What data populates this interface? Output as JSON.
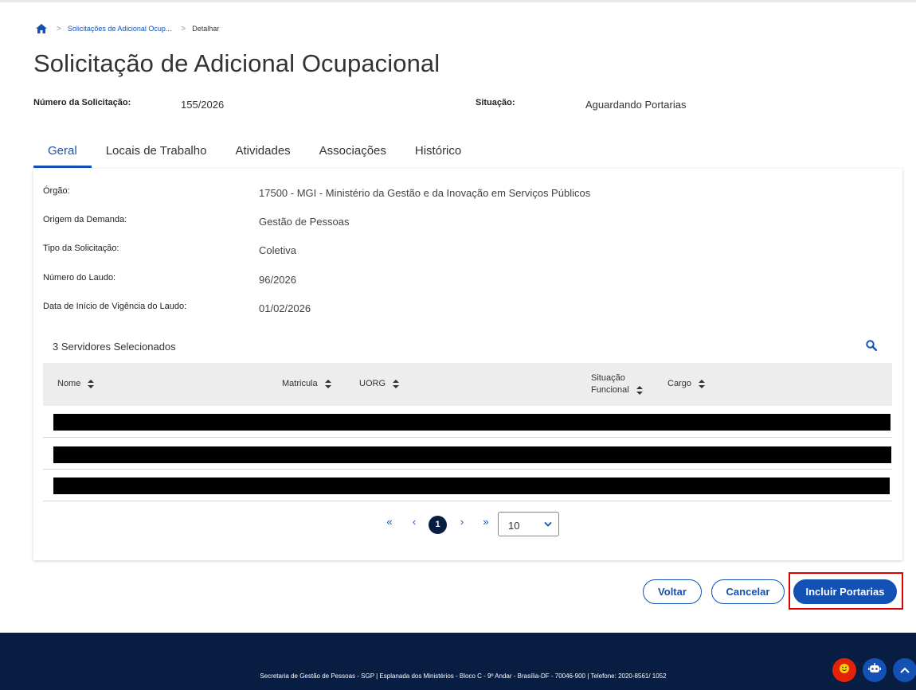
{
  "breadcrumb": {
    "items": [
      "Solicitações de Adicional Ocup...",
      "Detalhar"
    ]
  },
  "page": {
    "title": "Solicitação de Adicional Ocupacional"
  },
  "summary": {
    "numero_label": "Número da Solicitação:",
    "numero_value": "155/2026",
    "situacao_label": "Situação:",
    "situacao_value": "Aguardando Portarias"
  },
  "tabs": [
    {
      "label": "Geral",
      "active": true
    },
    {
      "label": "Locais de Trabalho",
      "active": false
    },
    {
      "label": "Atividades",
      "active": false
    },
    {
      "label": "Associações",
      "active": false
    },
    {
      "label": "Histórico",
      "active": false
    }
  ],
  "details": [
    {
      "label": "Órgão:",
      "value": "17500 - MGI - Ministério da Gestão e da Inovação em Serviços Públicos"
    },
    {
      "label": "Origem da Demanda:",
      "value": "Gestão de Pessoas"
    },
    {
      "label": "Tipo da Solicitação:",
      "value": "Coletiva"
    },
    {
      "label": "Número do Laudo:",
      "value": "96/2026"
    },
    {
      "label": "Data de Início de Vigência do Laudo:",
      "value": "01/02/2026"
    }
  ],
  "servidores": {
    "title": "3 Servidores Selecionados",
    "columns": {
      "nome": "Nome",
      "matricula": "Matricula",
      "uorg": "UORG",
      "situacao_1": "Situação",
      "situacao_2": "Funcional",
      "cargo": "Cargo"
    }
  },
  "pagination": {
    "first": "«",
    "prev": "‹",
    "current": "1",
    "next": "›",
    "last": "»",
    "page_size": "10"
  },
  "actions": {
    "voltar": "Voltar",
    "cancelar": "Cancelar",
    "incluir": "Incluir Portarias"
  },
  "footer": {
    "text": "Secretaria de Gestão de Pessoas - SGP | Esplanada dos Ministérios - Bloco C - 9º Andar - Brasília-DF - 70046-900 | Telefone: 2020-8561/ 1052"
  },
  "colors": {
    "primary": "#1351b4",
    "dark_blue": "#071d41",
    "highlight": "#e00000",
    "fab_red": "#e52207"
  },
  "icons": [
    "home-icon",
    "search-icon",
    "sort-icon",
    "chevron-down-icon",
    "emoji-icon",
    "robot-icon",
    "chevron-up-icon"
  ]
}
